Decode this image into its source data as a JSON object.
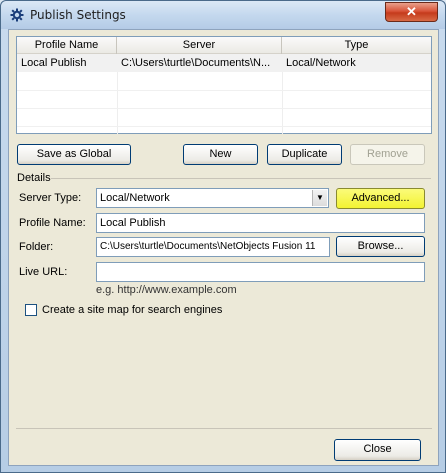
{
  "window": {
    "title": "Publish Settings",
    "close_glyph": "✕"
  },
  "table": {
    "columns": [
      "Profile Name",
      "Server",
      "Type"
    ],
    "rows": [
      {
        "profile": "Local Publish",
        "server": "C:\\Users\\turtle\\Documents\\N...",
        "type": "Local/Network"
      }
    ]
  },
  "buttons": {
    "save_global": "Save as Global",
    "new": "New",
    "duplicate": "Duplicate",
    "remove": "Remove",
    "advanced": "Advanced...",
    "browse": "Browse...",
    "close": "Close"
  },
  "details": {
    "group_label": "Details",
    "server_type_label": "Server Type:",
    "server_type_value": "Local/Network",
    "profile_name_label": "Profile Name:",
    "profile_name_value": "Local Publish",
    "folder_label": "Folder:",
    "folder_value": "C:\\Users\\turtle\\Documents\\NetObjects Fusion 11",
    "live_url_label": "Live URL:",
    "live_url_value": "",
    "live_url_hint": "e.g. http://www.example.com",
    "sitemap_label": "Create a site map for search engines",
    "sitemap_checked": false
  },
  "icons": {
    "app": "gear-icon",
    "close": "close-icon",
    "dropdown": "chevron-down-icon"
  },
  "colors": {
    "advanced_highlight": "#f3f332",
    "close_button": "#d9553a"
  }
}
